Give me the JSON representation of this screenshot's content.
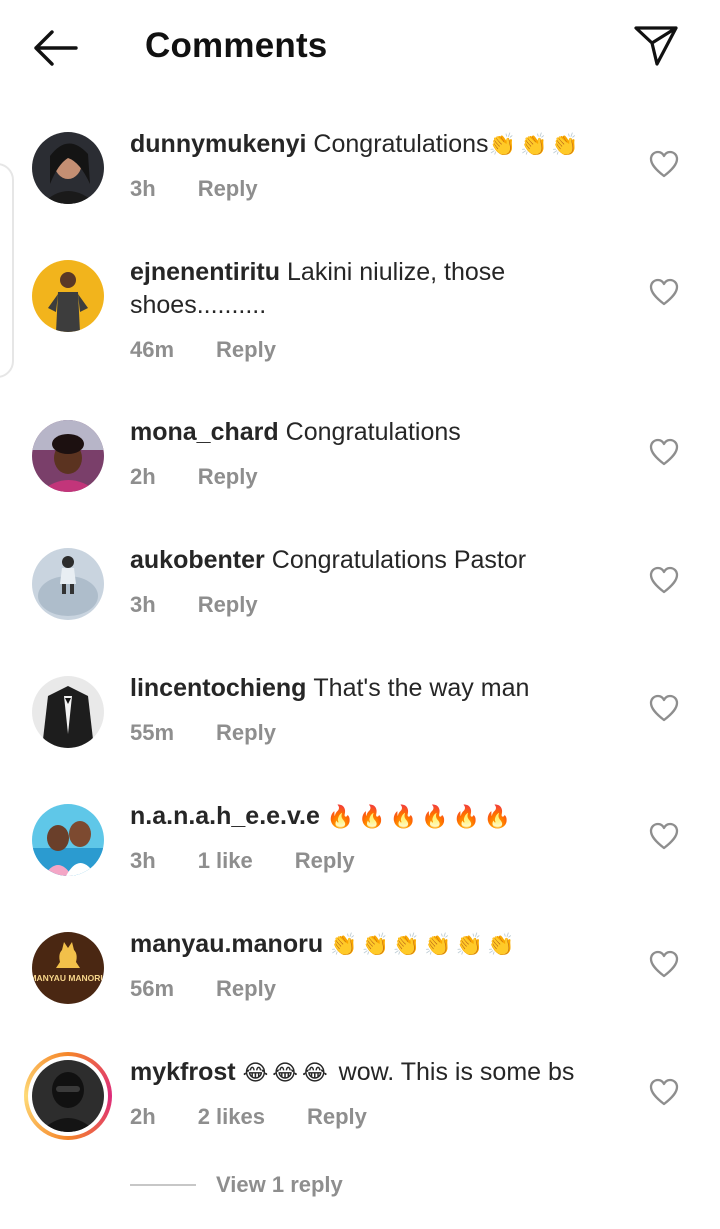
{
  "header": {
    "title": "Comments",
    "back_icon": "arrow-left-icon",
    "share_icon": "paper-plane-icon"
  },
  "comments": [
    {
      "username": "dunnymukenyi",
      "text": "Congratulations",
      "emoji": "👏👏👏",
      "time": "3h",
      "likes": "",
      "reply": "Reply"
    },
    {
      "username": "ejnenentiritu",
      "text": "Lakini niulize, those shoes..........",
      "emoji": "",
      "time": "46m",
      "likes": "",
      "reply": "Reply"
    },
    {
      "username": "mona_chard",
      "text": "Congratulations",
      "emoji": "",
      "time": "2h",
      "likes": "",
      "reply": "Reply"
    },
    {
      "username": "aukobenter",
      "text": "Congratulations Pastor",
      "emoji": "",
      "time": "3h",
      "likes": "",
      "reply": "Reply"
    },
    {
      "username": "lincentochieng",
      "text": "That's the way man",
      "emoji": "",
      "time": "55m",
      "likes": "",
      "reply": "Reply"
    },
    {
      "username": "n.a.n.a.h_e.e.v.e",
      "text": "",
      "emoji": "🔥🔥🔥🔥🔥🔥",
      "time": "3h",
      "likes": "1 like",
      "reply": "Reply"
    },
    {
      "username": "manyau.manoru",
      "text": "",
      "emoji": "👏👏👏👏👏👏",
      "time": "56m",
      "likes": "",
      "reply": "Reply",
      "avatar_text": "MANYAU MANORU"
    },
    {
      "username": "mykfrost",
      "text": "wow. This is some bs",
      "emoji": "😂😂😂",
      "time": "2h",
      "likes": "2 likes",
      "reply": "Reply"
    }
  ],
  "view_replies": "View 1 reply",
  "colors": {
    "text": "#262626",
    "meta": "#8e8e8e",
    "heart": "#8e8e8e"
  }
}
